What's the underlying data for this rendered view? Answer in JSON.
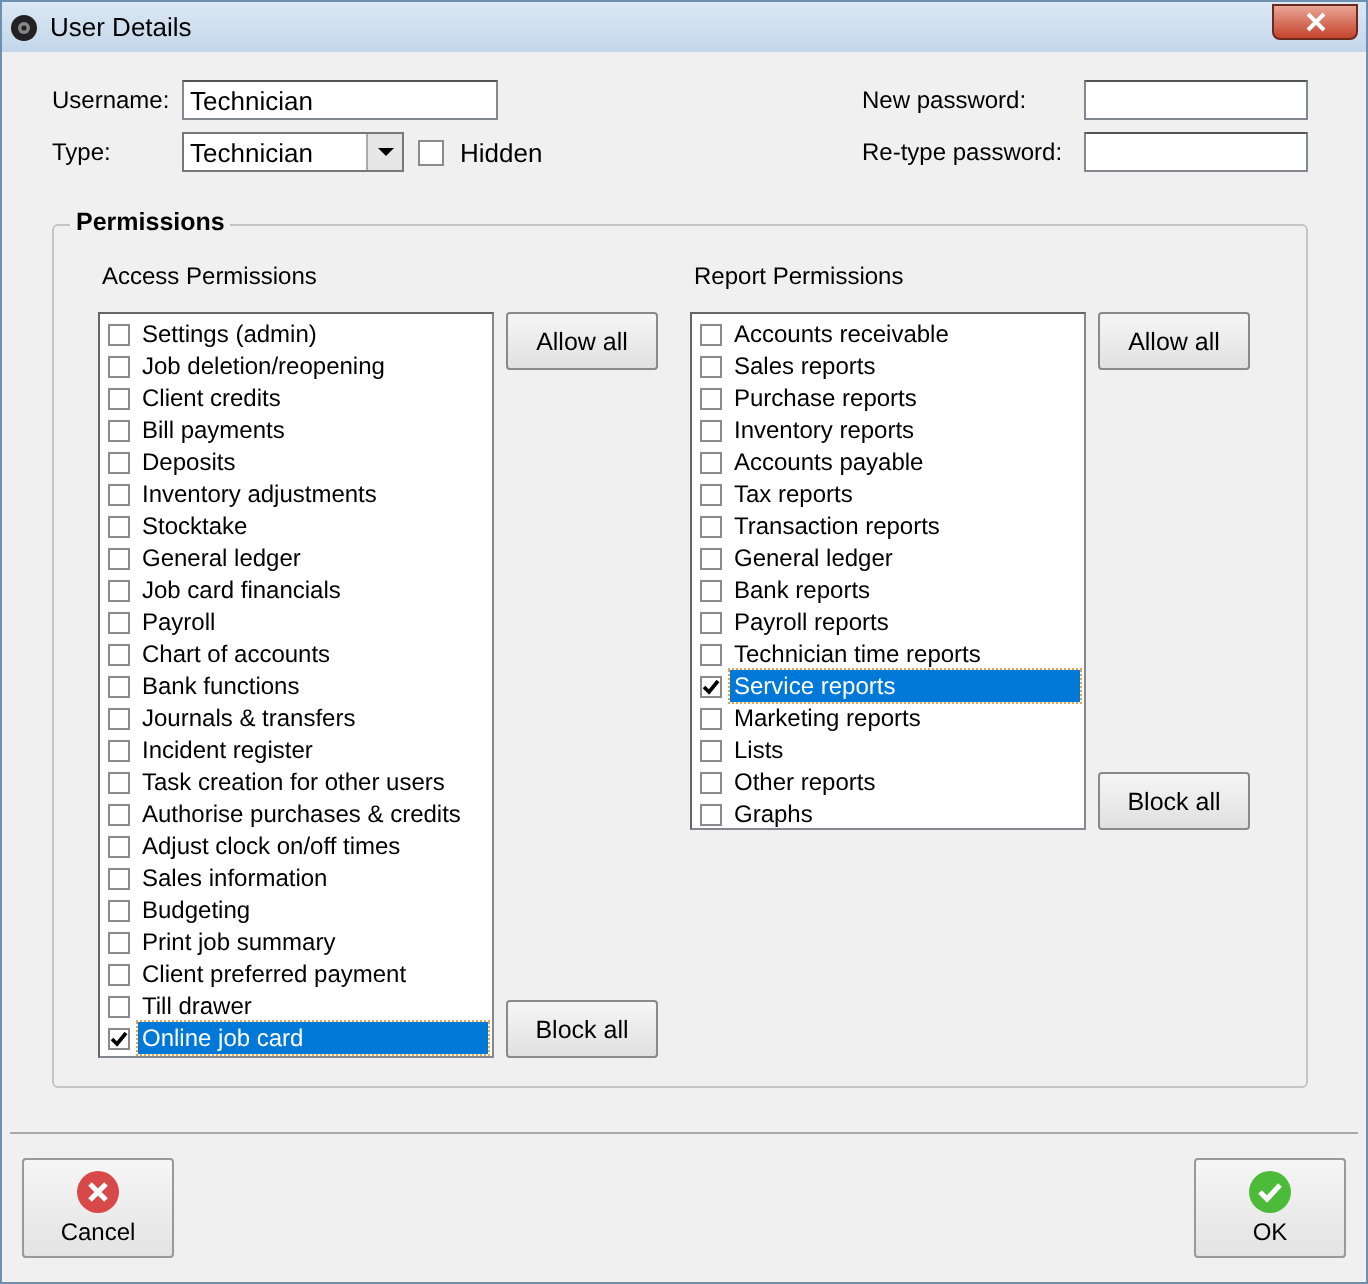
{
  "window": {
    "title": "User Details"
  },
  "username": {
    "label": "Username:",
    "value": "Technician"
  },
  "type": {
    "label": "Type:",
    "value": "Technician"
  },
  "hidden": {
    "label": "Hidden",
    "checked": false
  },
  "new_password": {
    "label": "New password:"
  },
  "retype_password": {
    "label": "Re-type password:"
  },
  "permissions": {
    "title": "Permissions",
    "groups": [
      {
        "title": "Access Permissions",
        "allow_button": "Allow all",
        "block_button": "Block all",
        "items": [
          {
            "label": "Settings (admin)",
            "checked": false,
            "selected": false
          },
          {
            "label": "Job deletion/reopening",
            "checked": false,
            "selected": false
          },
          {
            "label": "Client credits",
            "checked": false,
            "selected": false
          },
          {
            "label": "Bill payments",
            "checked": false,
            "selected": false
          },
          {
            "label": "Deposits",
            "checked": false,
            "selected": false
          },
          {
            "label": "Inventory adjustments",
            "checked": false,
            "selected": false
          },
          {
            "label": "Stocktake",
            "checked": false,
            "selected": false
          },
          {
            "label": "General ledger",
            "checked": false,
            "selected": false
          },
          {
            "label": "Job card financials",
            "checked": false,
            "selected": false
          },
          {
            "label": "Payroll",
            "checked": false,
            "selected": false
          },
          {
            "label": "Chart of accounts",
            "checked": false,
            "selected": false
          },
          {
            "label": "Bank functions",
            "checked": false,
            "selected": false
          },
          {
            "label": "Journals & transfers",
            "checked": false,
            "selected": false
          },
          {
            "label": "Incident register",
            "checked": false,
            "selected": false
          },
          {
            "label": "Task creation for other users",
            "checked": false,
            "selected": false
          },
          {
            "label": "Authorise purchases & credits",
            "checked": false,
            "selected": false
          },
          {
            "label": "Adjust clock on/off times",
            "checked": false,
            "selected": false
          },
          {
            "label": "Sales information",
            "checked": false,
            "selected": false
          },
          {
            "label": "Budgeting",
            "checked": false,
            "selected": false
          },
          {
            "label": "Print job summary",
            "checked": false,
            "selected": false
          },
          {
            "label": "Client preferred payment",
            "checked": false,
            "selected": false
          },
          {
            "label": "Till drawer",
            "checked": false,
            "selected": false
          },
          {
            "label": "Online job card",
            "checked": true,
            "selected": true
          }
        ]
      },
      {
        "title": "Report Permissions",
        "allow_button": "Allow all",
        "block_button": "Block all",
        "items": [
          {
            "label": "Accounts receivable",
            "checked": false,
            "selected": false
          },
          {
            "label": "Sales reports",
            "checked": false,
            "selected": false
          },
          {
            "label": "Purchase reports",
            "checked": false,
            "selected": false
          },
          {
            "label": "Inventory reports",
            "checked": false,
            "selected": false
          },
          {
            "label": "Accounts payable",
            "checked": false,
            "selected": false
          },
          {
            "label": "Tax reports",
            "checked": false,
            "selected": false
          },
          {
            "label": "Transaction reports",
            "checked": false,
            "selected": false
          },
          {
            "label": "General ledger",
            "checked": false,
            "selected": false
          },
          {
            "label": "Bank reports",
            "checked": false,
            "selected": false
          },
          {
            "label": "Payroll reports",
            "checked": false,
            "selected": false
          },
          {
            "label": "Technician time reports",
            "checked": false,
            "selected": false
          },
          {
            "label": "Service reports",
            "checked": true,
            "selected": true
          },
          {
            "label": "Marketing reports",
            "checked": false,
            "selected": false
          },
          {
            "label": "Lists",
            "checked": false,
            "selected": false
          },
          {
            "label": "Other reports",
            "checked": false,
            "selected": false
          },
          {
            "label": "Graphs",
            "checked": false,
            "selected": false
          }
        ]
      }
    ]
  },
  "buttons": [
    {
      "label": "Cancel",
      "kind": "cancel"
    },
    {
      "label": "OK",
      "kind": "ok"
    }
  ]
}
